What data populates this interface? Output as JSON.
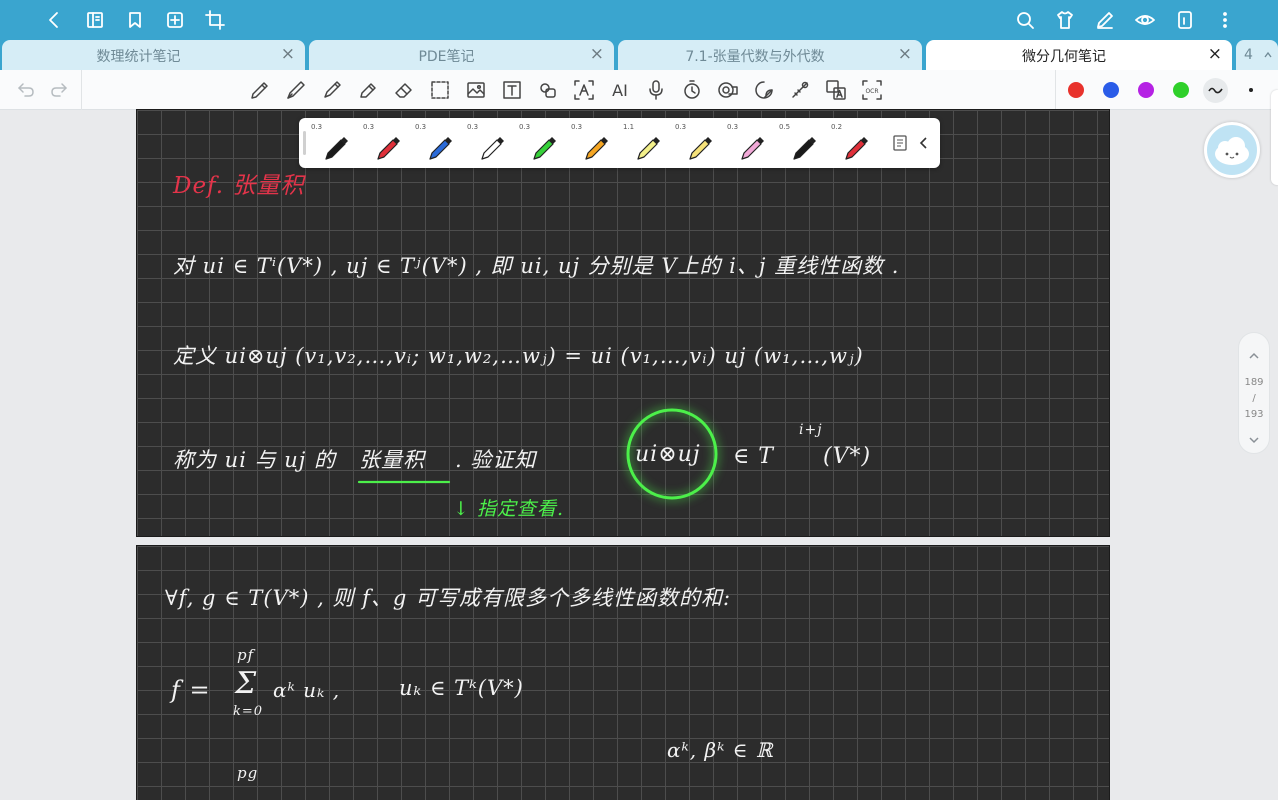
{
  "tabs": [
    {
      "label": "数理统计笔记",
      "close": "×"
    },
    {
      "label": "PDE笔记",
      "close": "×"
    },
    {
      "label": "7.1-张量代数与外代数",
      "close": "×"
    },
    {
      "label": "微分几何笔记",
      "close": "×"
    },
    {
      "label": "4"
    }
  ],
  "toolbar": {
    "ai_label": "AI",
    "ocr_label": "OCR",
    "colors": [
      "#e8322c",
      "#2a5ce8",
      "#b522e4",
      "#2fd02a"
    ]
  },
  "pens": [
    {
      "size": "0.3",
      "color": "#1a1a1a"
    },
    {
      "size": "0.3",
      "color": "#e0303a"
    },
    {
      "size": "0.3",
      "color": "#2a6ad8"
    },
    {
      "size": "0.3",
      "color": "#ffffff"
    },
    {
      "size": "0.3",
      "color": "#37d13a"
    },
    {
      "size": "0.3",
      "color": "#f5a623"
    },
    {
      "size": "1.1",
      "color": "#f3f08a"
    },
    {
      "size": "0.3",
      "color": "#f6e27a"
    },
    {
      "size": "0.3",
      "color": "#f2a9d8"
    },
    {
      "size": "0.5",
      "color": "#1a1a1a"
    },
    {
      "size": "0.2",
      "color": "#e0303a"
    }
  ],
  "page1": {
    "heading": "Def. 张量积",
    "line1": "对 ui ∈ Tⁱ(V*) ,  uj ∈ Tʲ(V*) , 即 ui, uj 分别是 V上的 i、j 重线性函数 .",
    "line2": "定义   ui⊗uj (v₁,v₂,…,vᵢ; w₁,w₂,…wⱼ) =  ui (v₁,…,vᵢ) uj (w₁,…,wⱼ)",
    "line3a": "称为 ui 与 uj 的",
    "line3b": "张量积",
    "line3c": ".   验证知",
    "circled": "ui⊗uj",
    "line3d": "∈  T",
    "sup": "i+j",
    "line3e": "(V*)",
    "note": "↓ 指定查看."
  },
  "page2": {
    "line1": "∀f, g ∈ T(V*) ,   则 f、g 可写成有限多个多线性函数的和:",
    "f_def": "f =",
    "sum_top": "pf",
    "sum_sym": "Σ",
    "sum_bot": "k=0",
    "f_term": "αᵏ uₖ ,",
    "uk": "uₖ ∈ Tᵏ(V*)",
    "alpha": "αᵏ, βᵏ ∈ ℝ",
    "g_top": "pg"
  },
  "pager": {
    "current": "189",
    "slash": "/",
    "total": "193"
  }
}
